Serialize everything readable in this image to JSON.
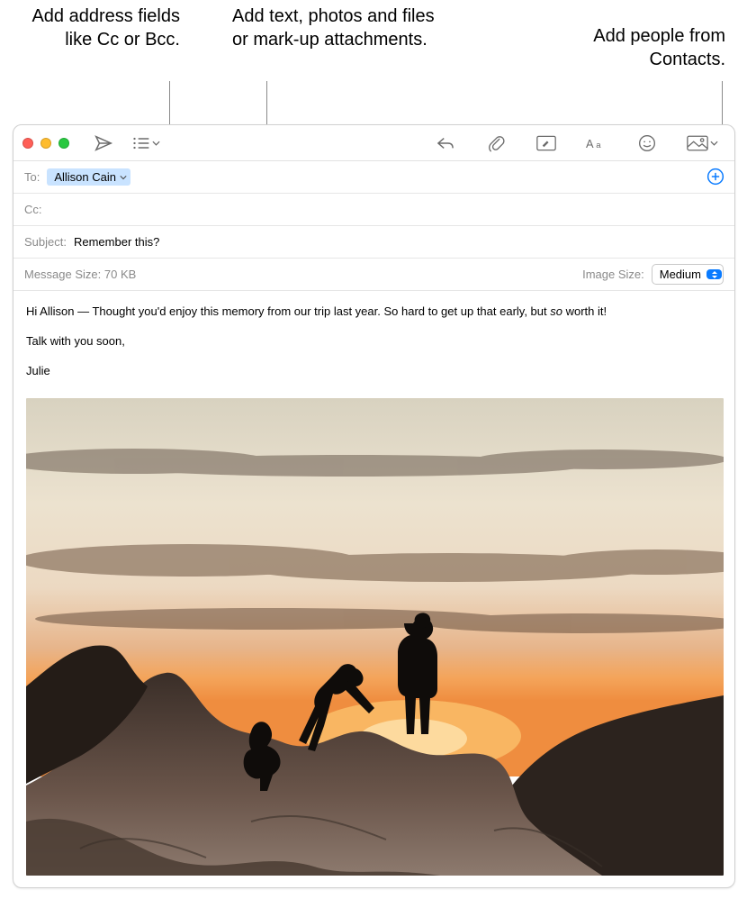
{
  "callouts": {
    "left": "Add address fields like Cc or Bcc.",
    "mid": "Add text, photos and files or mark-up attachments.",
    "right": "Add people from Contacts."
  },
  "compose": {
    "to_label": "To:",
    "to_token": "Allison Cain",
    "cc_label": "Cc:",
    "subject_label": "Subject:",
    "subject_value": "Remember this?",
    "message_size_label": "Message Size:",
    "message_size_value": "70 KB",
    "image_size_label": "Image Size:",
    "image_size_value": "Medium"
  },
  "body": {
    "line1_a": "Hi Allison — Thought you'd enjoy this memory from our trip last year. So hard to get up that early, but ",
    "line1_em": "so",
    "line1_b": " worth it!",
    "line2": "Talk with you soon,",
    "sign": "Julie"
  },
  "colors": {
    "accent": "#0a7bff"
  }
}
